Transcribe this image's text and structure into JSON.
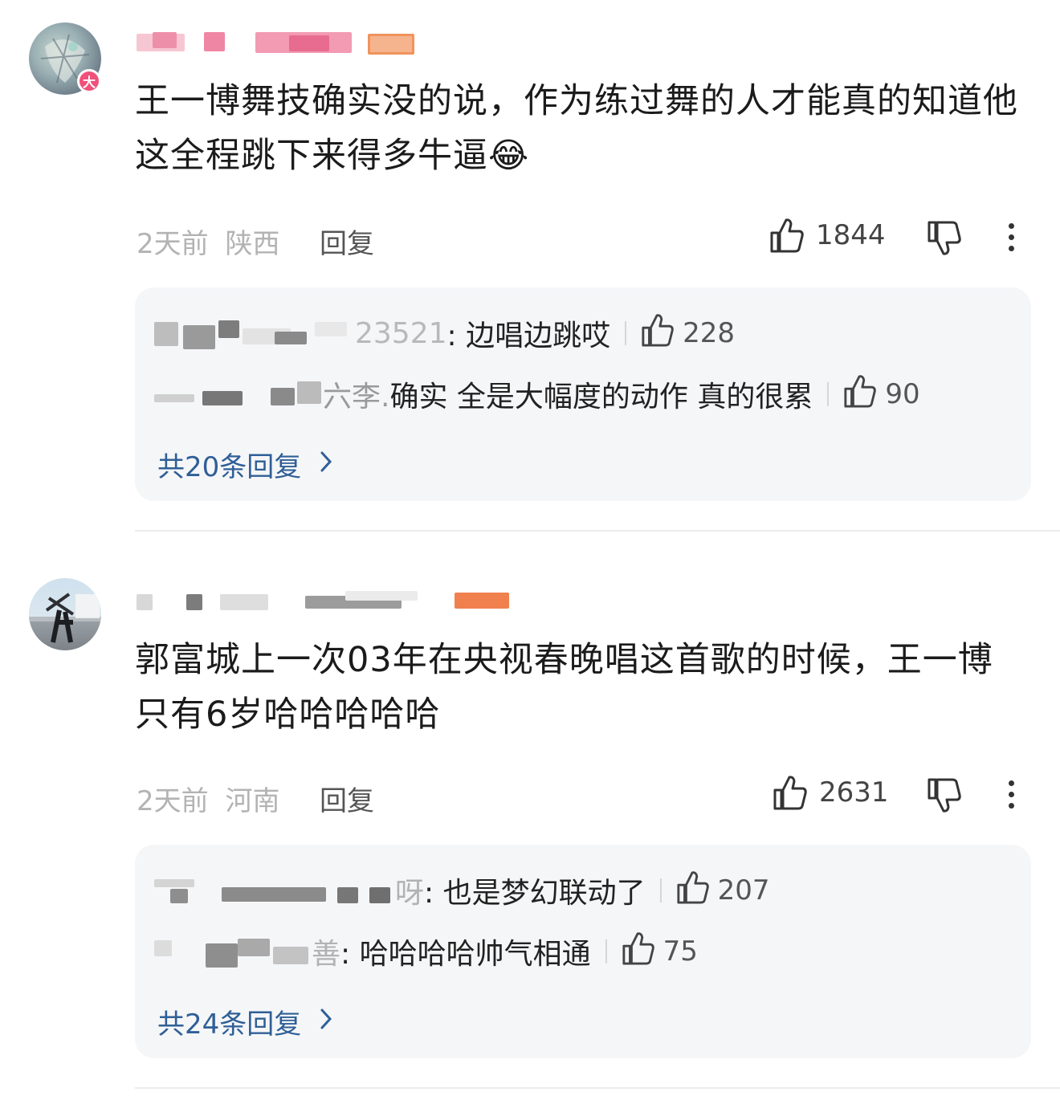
{
  "comments": [
    {
      "avatar_badge": "大",
      "text": "王一博舞技确实没的说，作为练过舞的人才能真的知道他这全程跳下来得多牛逼😂",
      "time": "2天前",
      "location": "陕西",
      "reply_label": "回复",
      "likes": "1844",
      "replies": [
        {
          "visible_name_tail": "23521",
          "text": ": 边唱边跳哎",
          "likes": "228"
        },
        {
          "visible_name_tail": "六李.",
          "text": " 确实 全是大幅度的动作 真的很累",
          "likes": "90"
        }
      ],
      "more_replies": "共20条回复"
    },
    {
      "avatar_badge": "",
      "text": "郭富城上一次03年在央视春晚唱这首歌的时候，王一博只有6岁哈哈哈哈哈",
      "time": "2天前",
      "location": "河南",
      "reply_label": "回复",
      "likes": "2631",
      "replies": [
        {
          "visible_name_tail": "呀",
          "text": ": 也是梦幻联动了",
          "likes": "207"
        },
        {
          "visible_name_tail": "善",
          "text": ": 哈哈哈哈帅气相通",
          "likes": "75"
        }
      ],
      "more_replies": "共24条回复"
    }
  ],
  "colors": {
    "link": "#2f5f96",
    "reply_bg": "#f5f6f8",
    "badge": "#f0507a",
    "meta": "#b3b3b3"
  },
  "icons": [
    "thumbs-up-icon",
    "thumbs-down-icon",
    "more-vertical-icon",
    "chevron-right-icon"
  ]
}
